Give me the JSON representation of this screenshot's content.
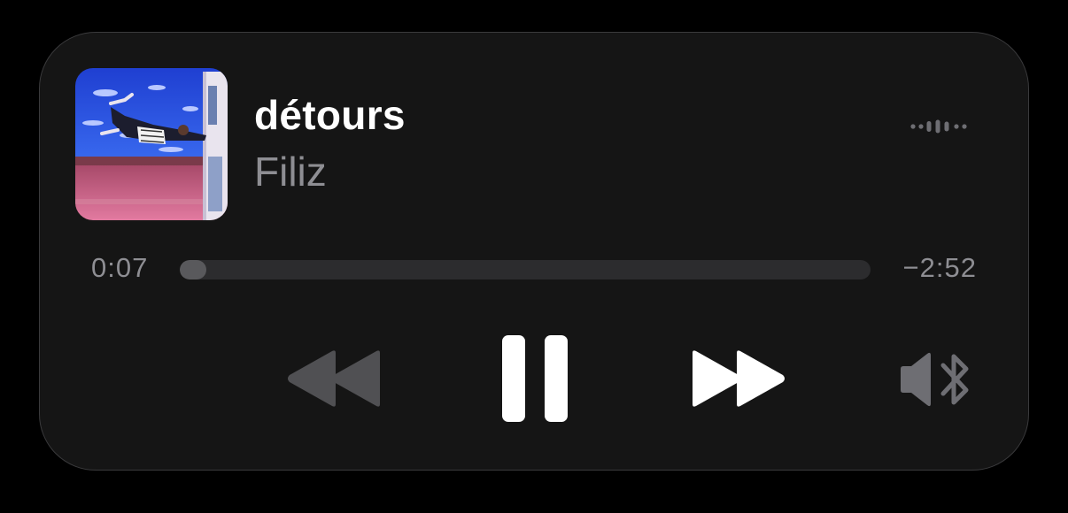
{
  "track": {
    "title": "détours",
    "artist": "Filiz",
    "artwork_icon": "album-artwork"
  },
  "playback": {
    "elapsed": "0:07",
    "remaining": "−2:52",
    "progress": 0.039,
    "state": "playing"
  },
  "controls": {
    "rewind_icon": "backward-icon",
    "pause_icon": "pause-icon",
    "forward_icon": "forward-icon",
    "output_icon": "speaker-bluetooth-icon",
    "waveform_icon": "waveform-icon"
  },
  "colors": {
    "background": "#000000",
    "card": "#151515",
    "primary_text": "#ffffff",
    "secondary_text": "#8e8e93",
    "disabled_control": "#505053",
    "track_background": "#2c2c2e",
    "track_fill": "#59595c"
  }
}
